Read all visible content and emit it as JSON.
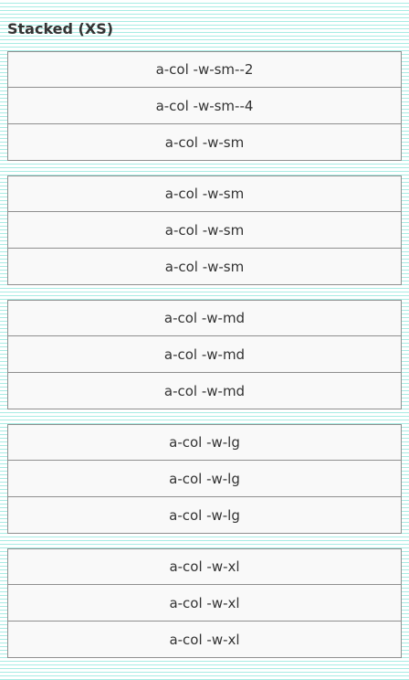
{
  "heading": "Stacked (XS)",
  "colors": {
    "grid_line": "#a8ece4",
    "cell_background": "#f9f9f9",
    "cell_border": "#8f8f8f",
    "text": "#333333"
  },
  "stacks": [
    {
      "cells": [
        "a-col -w-sm--2",
        "a-col -w-sm--4",
        "a-col -w-sm"
      ]
    },
    {
      "cells": [
        "a-col -w-sm",
        "a-col -w-sm",
        "a-col -w-sm"
      ]
    },
    {
      "cells": [
        "a-col -w-md",
        "a-col -w-md",
        "a-col -w-md"
      ]
    },
    {
      "cells": [
        "a-col -w-lg",
        "a-col -w-lg",
        "a-col -w-lg"
      ]
    },
    {
      "cells": [
        "a-col -w-xl",
        "a-col -w-xl",
        "a-col -w-xl"
      ]
    }
  ]
}
